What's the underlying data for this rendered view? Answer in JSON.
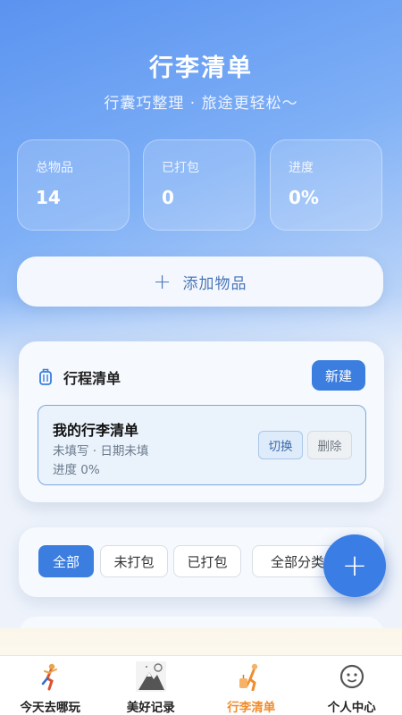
{
  "header": {
    "title": "行李清单",
    "subtitle": "行囊巧整理 · 旅途更轻松～"
  },
  "stats": [
    {
      "label": "总物品",
      "value": "14"
    },
    {
      "label": "已打包",
      "value": "0"
    },
    {
      "label": "进度",
      "value": "0%"
    }
  ],
  "add_button": {
    "icon": "plus-icon",
    "label": "添加物品"
  },
  "trip_list": {
    "icon": "luggage-icon",
    "title": "行程清单",
    "new_button": "新建",
    "items": [
      {
        "name": "我的行李清单",
        "meta": "未填写 · 日期未填",
        "progress": "进度 0%",
        "switch_button": "切换",
        "delete_button": "删除"
      }
    ]
  },
  "filters": {
    "chips": [
      "全部",
      "未打包",
      "已打包"
    ],
    "active": "全部",
    "category_select": "全部分类"
  },
  "fab": {
    "icon": "plus-icon"
  },
  "tabbar": {
    "active": "行李清单",
    "items": [
      {
        "label": "今天去哪玩",
        "icon": "runner-icon"
      },
      {
        "label": "美好记录",
        "icon": "mountain-icon"
      },
      {
        "label": "行李清单",
        "icon": "traveler-icon"
      },
      {
        "label": "个人中心",
        "icon": "face-icon"
      }
    ]
  },
  "colors": {
    "accent": "#3b7ee0",
    "active_tab": "#f08c2c"
  }
}
